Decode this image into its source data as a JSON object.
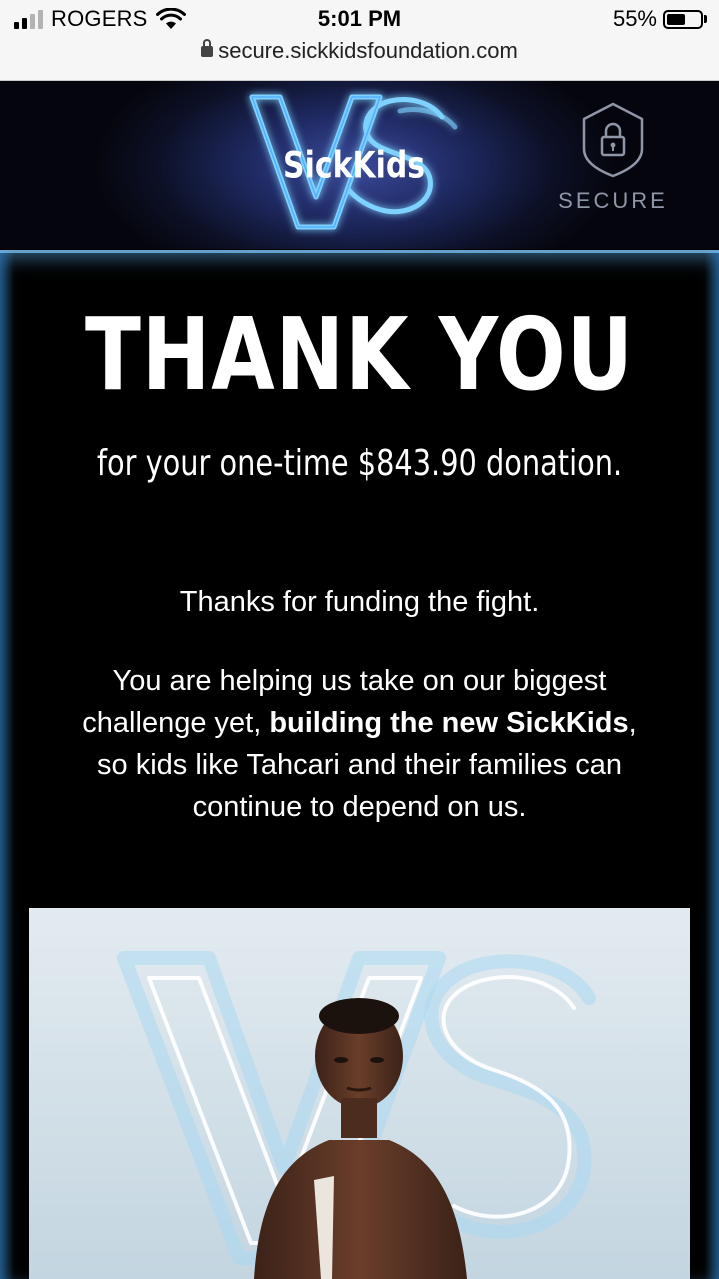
{
  "status_bar": {
    "carrier": "ROGERS",
    "time": "5:01 PM",
    "battery_percent": "55%",
    "battery_level": 0.55,
    "url": "secure.sickkidsfoundation.com"
  },
  "header": {
    "logo_text": "SickKids",
    "logo_mark": "VS",
    "secure_label": "SECURE"
  },
  "main": {
    "heading": "THANK YOU",
    "donation_line": "for your one-time $843.90 donation.",
    "thanks_line": "Thanks for funding the fight.",
    "body_pre": "You are helping us take on our biggest challenge yet, ",
    "body_bold": "building the new SickKids",
    "body_post": ", so kids like Tahcari and their families can continue to depend on us."
  },
  "icons": {
    "wifi": "wifi-icon",
    "lock": "lock-icon",
    "shield": "shield-lock-icon"
  },
  "colors": {
    "neon_blue": "#4fb4ff",
    "background": "#000000",
    "text": "#ffffff"
  }
}
